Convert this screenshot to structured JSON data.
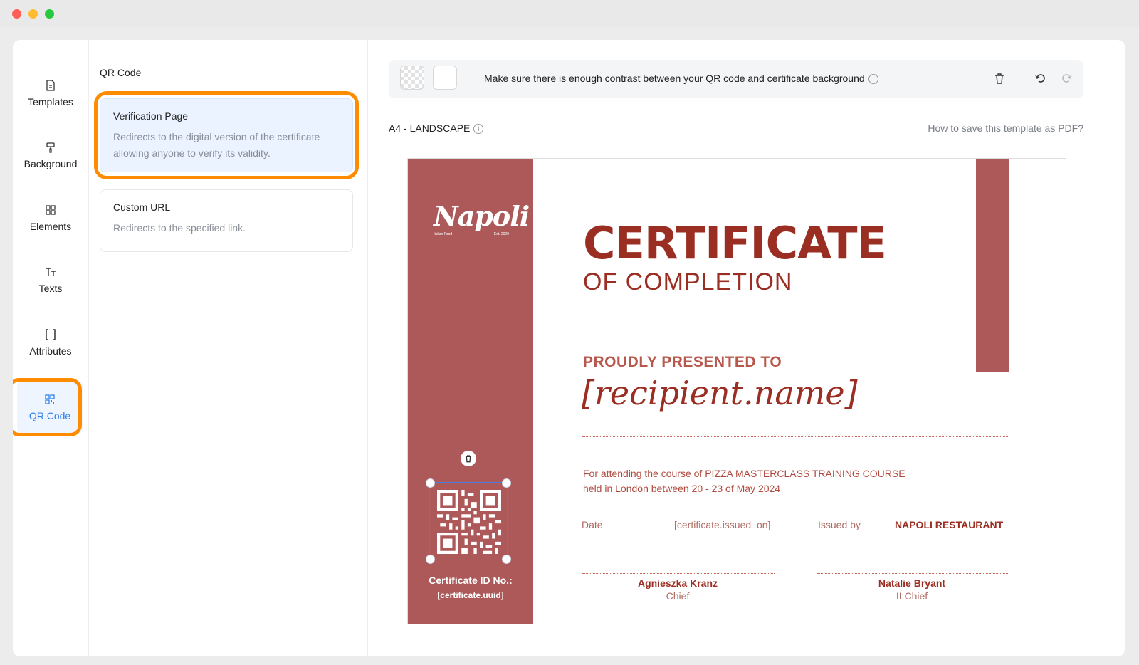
{
  "sidebar": {
    "items": [
      {
        "label": "Templates",
        "icon": "document-icon"
      },
      {
        "label": "Background",
        "icon": "paint-roller-icon"
      },
      {
        "label": "Elements",
        "icon": "elements-grid-icon"
      },
      {
        "label": "Texts",
        "icon": "text-icon"
      },
      {
        "label": "Attributes",
        "icon": "brackets-icon"
      },
      {
        "label": "QR Code",
        "icon": "qr-code-icon",
        "active": true
      }
    ]
  },
  "panel": {
    "title": "QR Code",
    "options": [
      {
        "title": "Verification Page",
        "desc": "Redirects to the digital version of the certificate allowing anyone to verify its validity.",
        "selected": true
      },
      {
        "title": "Custom URL",
        "desc": "Redirects to the specified link.",
        "selected": false
      }
    ]
  },
  "toolbar": {
    "tip": "Make sure there is enough contrast between your QR code and certificate background"
  },
  "canvas": {
    "size_label": "A4 - LANDSCAPE",
    "help_link": "How to save this template as PDF?"
  },
  "certificate": {
    "logo": "Napoli",
    "logo_left": "Italian Food",
    "logo_right": "Est. 2020",
    "title": "CERTIFICATE",
    "subtitle": "OF COMPLETION",
    "presented": "PROUDLY PRESENTED TO",
    "recipient": "[recipient.name]",
    "course_line1": "For attending the course of PIZZA MASTERCLASS TRAINING COURSE",
    "course_line2": "held in London between 20 - 23 of May 2024",
    "date_label": "Date",
    "date_value": "[certificate.issued_on]",
    "issued_label": "Issued by",
    "issued_value": "NAPOLI RESTAURANT",
    "sig1_name": "Agnieszka Kranz",
    "sig1_role": "Chief",
    "sig2_name": "Natalie Bryant",
    "sig2_role": "II Chief",
    "cert_id_label": "Certificate ID No.:",
    "cert_id_value": "[certificate.uuid]"
  },
  "colors": {
    "accent": "#2f80ed",
    "highlight": "#ff8c00",
    "band": "#ad5959",
    "title": "#9b2e22"
  }
}
